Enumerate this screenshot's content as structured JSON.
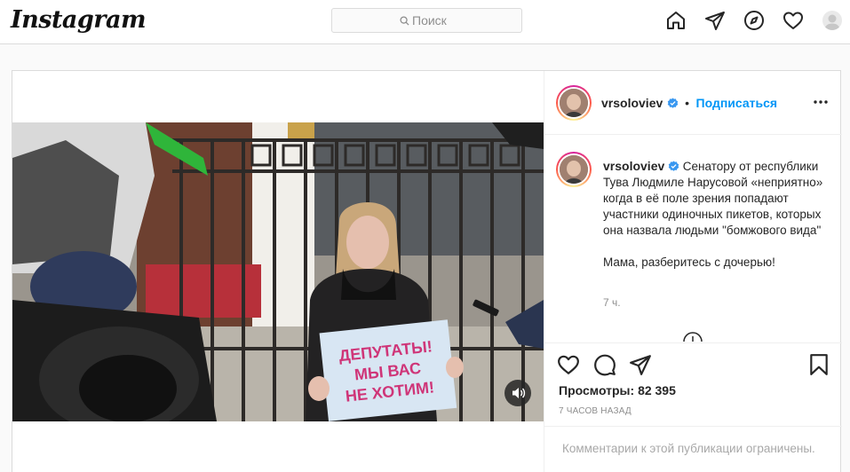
{
  "nav": {
    "logo": "Instagram",
    "search_placeholder": "Поиск",
    "icons": [
      "home-icon",
      "direct-icon",
      "explore-icon",
      "activity-icon",
      "profile-avatar"
    ]
  },
  "post": {
    "username": "vrsoloviev",
    "separator": "•",
    "follow_label": "Подписаться",
    "caption_username": "vrsoloviev",
    "caption_text": "Сенатору от республики Тува Людмиле Нарусовой «неприятно» когда в её поле зрения попадают участники одиночных пикетов, которых она назвала людьми \"бомжового вида\"\n\nМама, разберитесь с дочерью!",
    "caption_time": "7 ч.",
    "views_label": "Просмотры:",
    "views_count": "82 395",
    "posted_ago": "7 ЧАСОВ НАЗАД",
    "comments_disabled": "Комментарии к этой публикации ограничены.",
    "sign_line1": "ДЕПУТАТЫ!",
    "sign_line2": "МЫ ВАС",
    "sign_line3": "НЕ ХОТИМ!"
  },
  "colors": {
    "accent": "#0095f6",
    "verified": "#3897f0",
    "border": "#dbdbdb",
    "sign_text": "#cf3578",
    "sign_bg": "#d8e6f3"
  }
}
